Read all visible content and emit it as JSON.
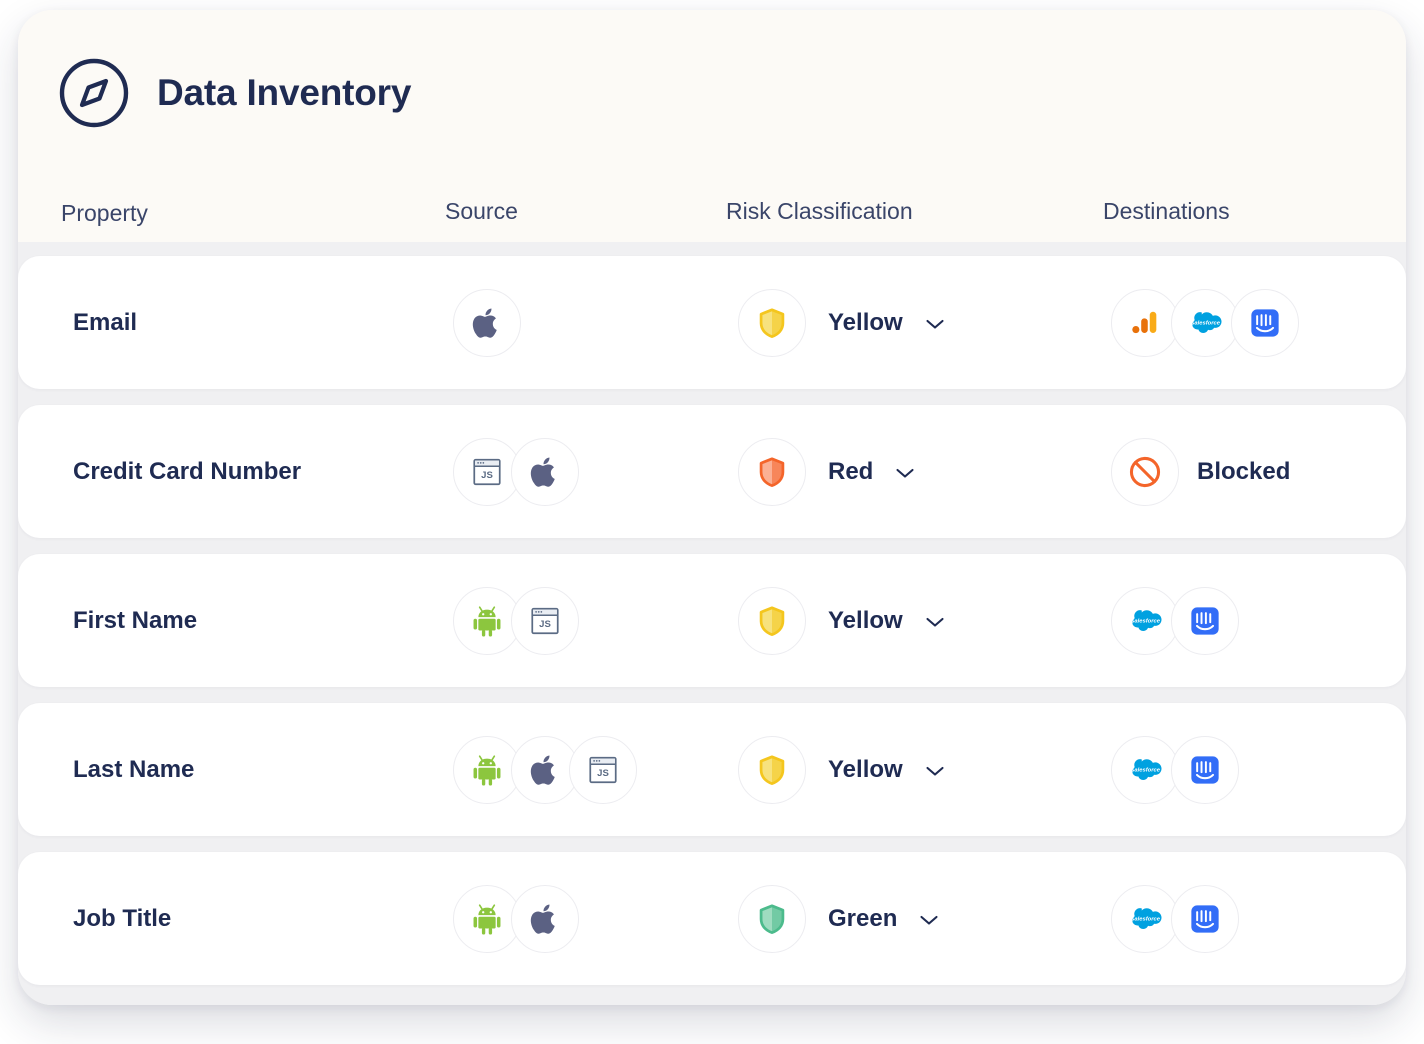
{
  "header": {
    "title": "Data Inventory",
    "brand_icon": "compass-icon"
  },
  "columns": {
    "property": "Property",
    "source": "Source",
    "risk": "Risk Classification",
    "destinations": "Destinations"
  },
  "colors": {
    "title_navy": "#1f2b52",
    "card_header_bg": "#fcfaf6",
    "rows_bg": "#f0f0f2",
    "row_bg": "#ffffff",
    "risk_yellow": "#f4c61e",
    "risk_yellow_fill": "#f7e27e",
    "risk_red": "#f4652a",
    "risk_red_fill": "#fbb094",
    "risk_green": "#4cbb8c",
    "risk_green_fill": "#9fdcc0",
    "blocked_orange": "#f4652a",
    "android_green": "#8cc63e",
    "apple_slate": "#5b6183",
    "js_slate": "#5b6b84",
    "salesforce_blue": "#00a1e0",
    "intercom_blue": "#326df7",
    "ga_amber": "#f9ab18",
    "ga_orange": "#e8710a"
  },
  "rows": [
    {
      "property": "Email",
      "sources": [
        "apple-icon"
      ],
      "risk": {
        "level": "Yellow",
        "icon": "shield-yellow-icon",
        "dropdown": "chevron-down-icon"
      },
      "destinations": [
        "google-analytics-icon",
        "salesforce-icon",
        "intercom-icon"
      ],
      "blocked": false,
      "blocked_label": ""
    },
    {
      "property": "Credit Card Number",
      "sources": [
        "js-browser-icon",
        "apple-icon"
      ],
      "risk": {
        "level": "Red",
        "icon": "shield-red-icon",
        "dropdown": "chevron-down-icon"
      },
      "destinations": [],
      "blocked": true,
      "blocked_label": "Blocked"
    },
    {
      "property": "First Name",
      "sources": [
        "android-icon",
        "js-browser-icon"
      ],
      "risk": {
        "level": "Yellow",
        "icon": "shield-yellow-icon",
        "dropdown": "chevron-down-icon"
      },
      "destinations": [
        "salesforce-icon",
        "intercom-icon"
      ],
      "blocked": false,
      "blocked_label": ""
    },
    {
      "property": "Last Name",
      "sources": [
        "android-icon",
        "apple-icon",
        "js-browser-icon"
      ],
      "risk": {
        "level": "Yellow",
        "icon": "shield-yellow-icon",
        "dropdown": "chevron-down-icon"
      },
      "destinations": [
        "salesforce-icon",
        "intercom-icon"
      ],
      "blocked": false,
      "blocked_label": ""
    },
    {
      "property": "Job Title",
      "sources": [
        "android-icon",
        "apple-icon"
      ],
      "risk": {
        "level": "Green",
        "icon": "shield-green-icon",
        "dropdown": "chevron-down-icon"
      },
      "destinations": [
        "salesforce-icon",
        "intercom-icon"
      ],
      "blocked": false,
      "blocked_label": ""
    }
  ]
}
